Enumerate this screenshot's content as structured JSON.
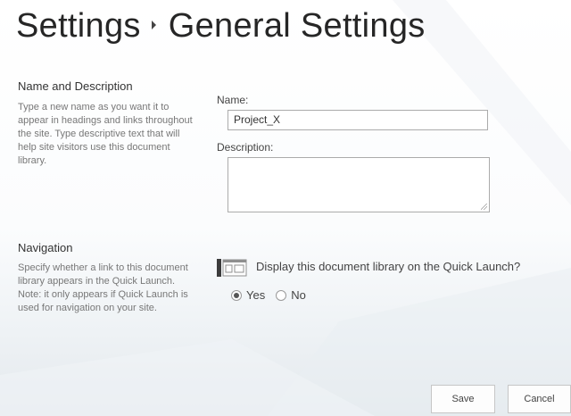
{
  "page": {
    "breadcrumb_root": "Settings",
    "breadcrumb_current": "General Settings"
  },
  "name_section": {
    "heading": "Name and Description",
    "description": "Type a new name as you want it to appear in headings and links throughout the site. Type descriptive text that will help site visitors use this document library.",
    "name_label": "Name:",
    "name_value": "Project_X",
    "description_label": "Description:",
    "description_value": ""
  },
  "navigation_section": {
    "heading": "Navigation",
    "description": "Specify whether a link to this document library appears in the Quick Launch. Note: it only appears if Quick Launch is used for navigation on your site.",
    "question": "Display this document library on the Quick Launch?",
    "icon": "quick-launch-icon",
    "options": [
      {
        "label": "Yes",
        "checked": true
      },
      {
        "label": "No",
        "checked": false
      }
    ]
  },
  "actions": {
    "save_label": "Save",
    "cancel_label": "Cancel"
  }
}
